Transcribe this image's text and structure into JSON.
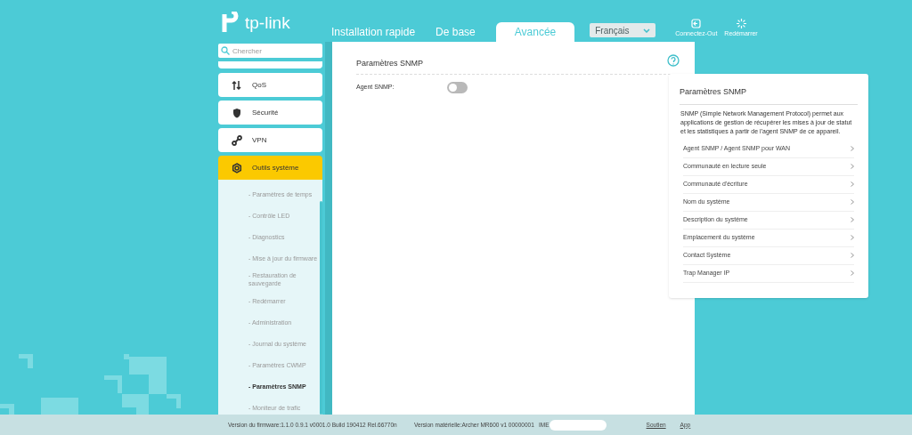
{
  "brand": "tp-link",
  "tabs": [
    {
      "label": "Installation rapide",
      "selected": false
    },
    {
      "label": "De base",
      "selected": false
    },
    {
      "label": "Avancée",
      "selected": true
    }
  ],
  "language": "Français",
  "header_actions": [
    {
      "kind": "logout",
      "label": "Connectez-Out"
    },
    {
      "kind": "reboot",
      "label": "Redémarrer"
    }
  ],
  "search": {
    "placeholder": "Chercher"
  },
  "sidebar": {
    "items": [
      {
        "kind": "qos",
        "label": "QoS",
        "selected": false
      },
      {
        "kind": "security",
        "label": "Sécurité",
        "selected": false
      },
      {
        "kind": "vpn",
        "label": "VPN",
        "selected": false
      },
      {
        "kind": "tools",
        "label": "Outils système",
        "selected": true,
        "children": [
          {
            "label": "- Paramètres de temps",
            "selected": false
          },
          {
            "label": "- Contrôle LED",
            "selected": false
          },
          {
            "label": "- Diagnostics",
            "selected": false
          },
          {
            "label": "- Mise à jour du firmware",
            "selected": false
          },
          {
            "label": "- Restauration de sauvegarde",
            "selected": false
          },
          {
            "label": "- Redémarrer",
            "selected": false
          },
          {
            "label": "- Administration",
            "selected": false
          },
          {
            "label": "- Journal du système",
            "selected": false
          },
          {
            "label": "- Paramètres CWMP",
            "selected": false
          },
          {
            "label": "- Paramètres SNMP",
            "selected": true
          },
          {
            "label": "- Moniteur de trafic",
            "selected": false
          }
        ]
      }
    ]
  },
  "panel": {
    "title": "Paramètres SNMP",
    "fields": [
      {
        "label": "Agent SNMP:",
        "on": false
      }
    ]
  },
  "help": {
    "title": "Paramètres SNMP",
    "description": "SNMP (Simple Network Management Protocol) permet aux applications de gestion de récupérer les mises à jour de statut et les statistiques à partir de l'agent SNMP de ce appareil.",
    "items": [
      "Agent SNMP / Agent SNMP pour WAN",
      "Communauté en lecture seule",
      "Communauté d'écriture",
      "Nom du système",
      "Description du système",
      "Emplacement du système",
      "Contact Système",
      "Trap Manager IP"
    ]
  },
  "footer": {
    "firmware": "Version du firmware:1.1.0 0.9.1 v0001.0 Build 190412 Rel.66770n",
    "hardware": "Version matérielle:Archer MR600 v1 00000001",
    "imei": "IME",
    "links": [
      "Soutien",
      "App"
    ]
  }
}
